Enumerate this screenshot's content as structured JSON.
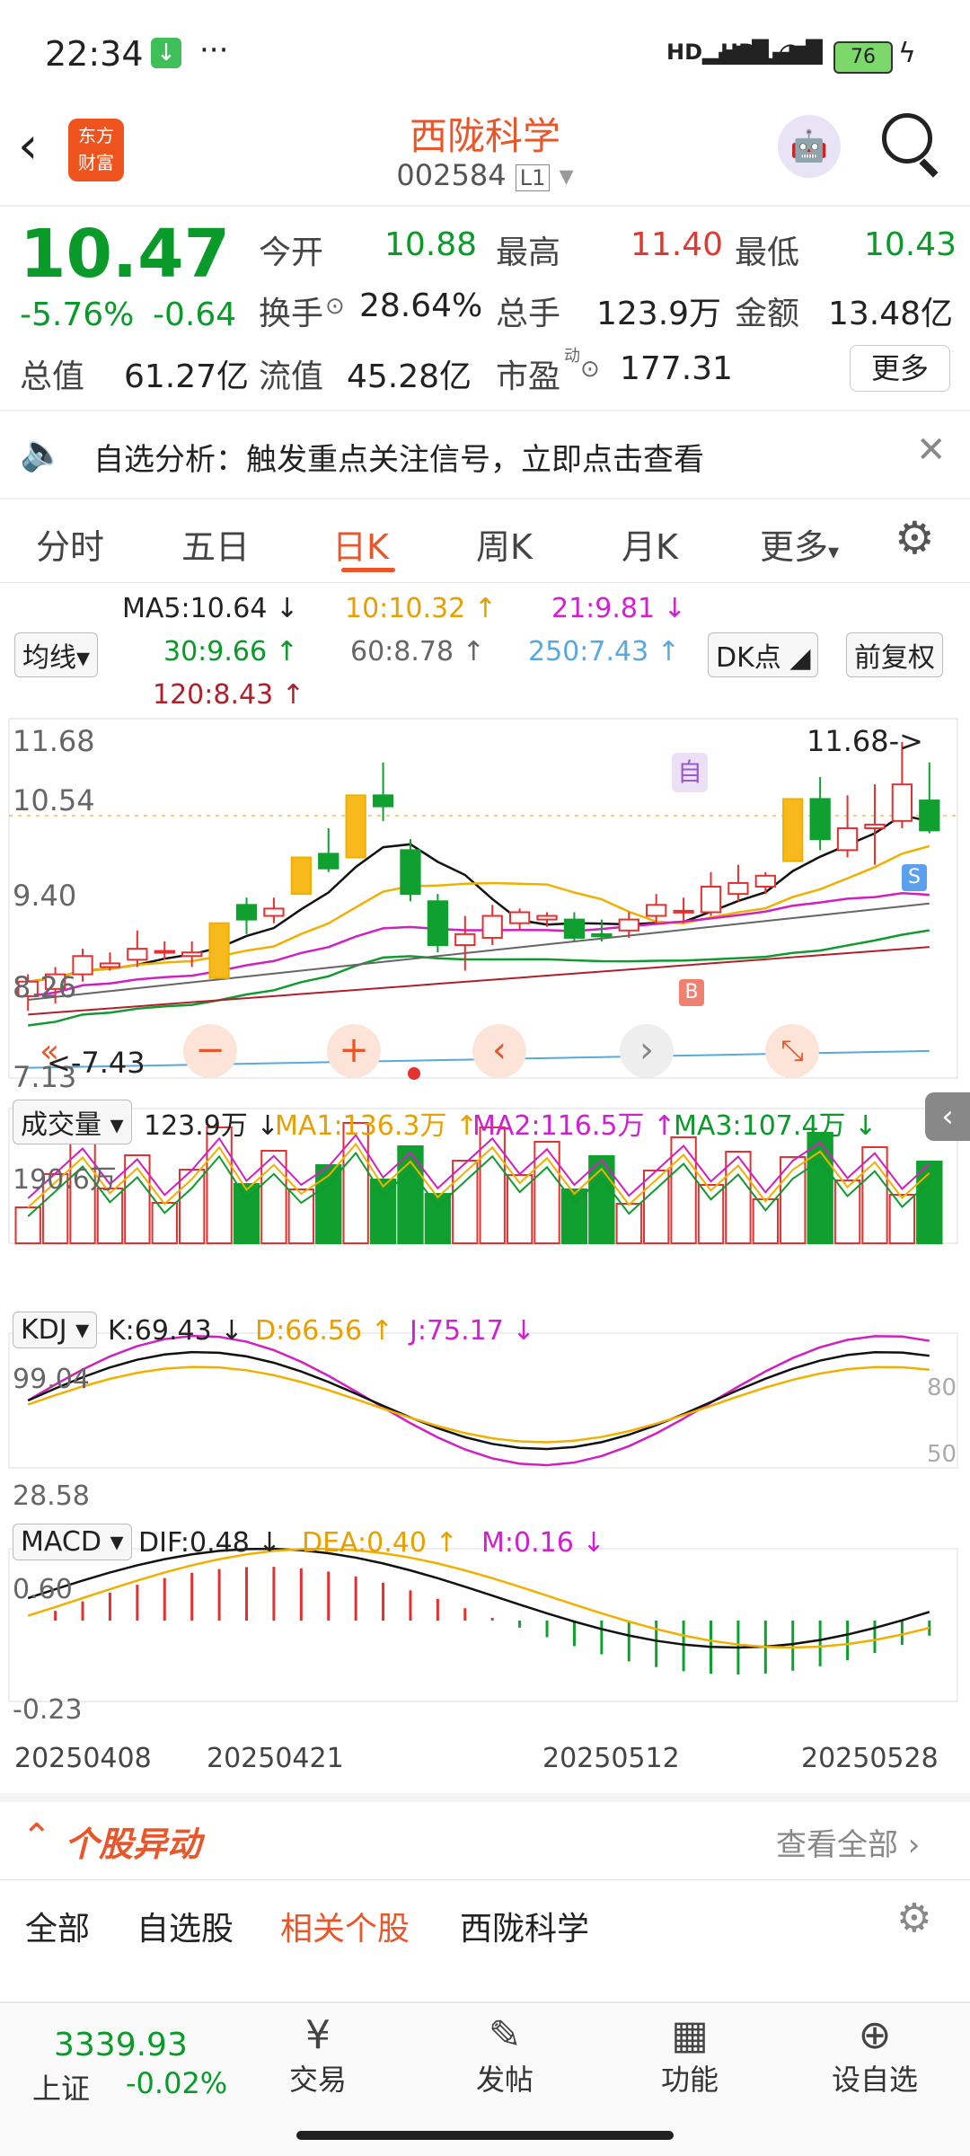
{
  "status_bar": {
    "time": "22:34",
    "battery": "76"
  },
  "header": {
    "title": "西陇科学",
    "code": "002584",
    "market_tag": "L1",
    "logo_line1": "东方",
    "logo_line2": "财富"
  },
  "quote": {
    "price": "10.47",
    "change_pct": "-5.76%",
    "change": "-0.64",
    "fields": [
      {
        "label": "今开",
        "value": "10.88",
        "color": "green"
      },
      {
        "label": "最高",
        "value": "11.40",
        "color": "red"
      },
      {
        "label": "最低",
        "value": "10.43",
        "color": "green"
      },
      {
        "label": "换手",
        "value": "28.64%",
        "color": "black"
      },
      {
        "label": "总手",
        "value": "123.9万",
        "color": "black"
      },
      {
        "label": "金额",
        "value": "13.48亿",
        "color": "black"
      },
      {
        "label": "总值",
        "value": "61.27亿",
        "color": "black"
      },
      {
        "label": "流值",
        "value": "45.28亿",
        "color": "black"
      },
      {
        "label": "市盈",
        "value": "177.31",
        "color": "black"
      }
    ],
    "pe_super": "动",
    "more_label": "更多"
  },
  "banner": {
    "text": "自选分析：触发重点关注信号，立即点击查看"
  },
  "tabs": [
    "分时",
    "五日",
    "日K",
    "周K",
    "月K",
    "更多"
  ],
  "active_tab": "日K",
  "ma": {
    "ma5": "MA5:10.64",
    "ma10": "10:10.32",
    "ma21": "21:9.81",
    "ma30": "30:9.66",
    "ma60": "60:8.78",
    "ma250": "250:7.43",
    "ma120": "120:8.43",
    "select_label": "均线",
    "dk_label": "DK点",
    "fq_label": "前复权"
  },
  "price_axis": {
    "top": "11.68",
    "mid1": "10.54",
    "mid2": "9.40",
    "low1": "8.26",
    "bottom": "7.13",
    "high_marker": "11.68->",
    "low_marker": "<-7.43"
  },
  "chart_data": {
    "type": "candlestick",
    "dates_shown": [
      "20250408",
      "20250421",
      "20250512",
      "20250528"
    ],
    "ylim": [
      7.13,
      11.68
    ],
    "candles": [
      {
        "o": 8.2,
        "c": 8.4,
        "h": 8.5,
        "l": 8.0,
        "up": true
      },
      {
        "o": 8.3,
        "c": 8.5,
        "h": 8.6,
        "l": 8.1,
        "up": true
      },
      {
        "o": 8.5,
        "c": 8.75,
        "h": 8.85,
        "l": 8.4,
        "up": true
      },
      {
        "o": 8.6,
        "c": 8.65,
        "h": 8.8,
        "l": 8.55,
        "up": true
      },
      {
        "o": 8.7,
        "c": 8.85,
        "h": 9.1,
        "l": 8.6,
        "up": true
      },
      {
        "o": 8.8,
        "c": 8.82,
        "h": 8.95,
        "l": 8.7,
        "up": true
      },
      {
        "o": 8.75,
        "c": 8.8,
        "h": 8.95,
        "l": 8.6,
        "up": true
      },
      {
        "o": 8.45,
        "c": 9.2,
        "h": 9.2,
        "l": 8.45,
        "up": true,
        "limit": true
      },
      {
        "o": 9.25,
        "c": 9.45,
        "h": 9.55,
        "l": 9.05,
        "up": false
      },
      {
        "o": 9.3,
        "c": 9.4,
        "h": 9.55,
        "l": 9.2,
        "up": true
      },
      {
        "o": 9.6,
        "c": 10.1,
        "h": 10.1,
        "l": 9.6,
        "up": true,
        "limit": true
      },
      {
        "o": 10.15,
        "c": 9.95,
        "h": 10.5,
        "l": 9.9,
        "up": false
      },
      {
        "o": 10.1,
        "c": 10.95,
        "h": 10.95,
        "l": 10.1,
        "up": true,
        "limit": true
      },
      {
        "o": 10.95,
        "c": 10.8,
        "h": 11.4,
        "l": 10.6,
        "up": false
      },
      {
        "o": 10.2,
        "c": 9.6,
        "h": 10.35,
        "l": 9.5,
        "up": false
      },
      {
        "o": 9.5,
        "c": 8.9,
        "h": 9.6,
        "l": 8.8,
        "up": false
      },
      {
        "o": 8.9,
        "c": 9.05,
        "h": 9.3,
        "l": 8.55,
        "up": true
      },
      {
        "o": 9.0,
        "c": 9.3,
        "h": 9.45,
        "l": 8.9,
        "up": true
      },
      {
        "o": 9.2,
        "c": 9.35,
        "h": 9.4,
        "l": 9.1,
        "up": true
      },
      {
        "o": 9.25,
        "c": 9.3,
        "h": 9.35,
        "l": 9.15,
        "up": true
      },
      {
        "o": 9.25,
        "c": 9.0,
        "h": 9.35,
        "l": 8.95,
        "up": false
      },
      {
        "o": 9.05,
        "c": 9.02,
        "h": 9.25,
        "l": 8.95,
        "up": false
      },
      {
        "o": 9.1,
        "c": 9.25,
        "h": 9.35,
        "l": 9.0,
        "up": true
      },
      {
        "o": 9.3,
        "c": 9.45,
        "h": 9.6,
        "l": 9.2,
        "up": true
      },
      {
        "o": 9.35,
        "c": 9.37,
        "h": 9.55,
        "l": 9.2,
        "up": true
      },
      {
        "o": 9.35,
        "c": 9.7,
        "h": 9.9,
        "l": 9.3,
        "up": true
      },
      {
        "o": 9.6,
        "c": 9.75,
        "h": 10.0,
        "l": 9.5,
        "up": true
      },
      {
        "o": 9.7,
        "c": 9.85,
        "h": 9.9,
        "l": 9.6,
        "up": true
      },
      {
        "o": 10.05,
        "c": 10.9,
        "h": 10.9,
        "l": 10.05,
        "up": true,
        "limit": true
      },
      {
        "o": 10.9,
        "c": 10.35,
        "h": 11.2,
        "l": 10.2,
        "up": false
      },
      {
        "o": 10.2,
        "c": 10.5,
        "h": 10.95,
        "l": 10.1,
        "up": true
      },
      {
        "o": 10.5,
        "c": 10.55,
        "h": 11.1,
        "l": 10.0,
        "up": true
      },
      {
        "o": 10.6,
        "c": 11.1,
        "h": 11.68,
        "l": 10.5,
        "up": true
      },
      {
        "o": 10.88,
        "c": 10.47,
        "h": 11.4,
        "l": 10.43,
        "up": false
      }
    ],
    "volume_label": "成交量",
    "volume_value": "123.9万",
    "vol_ma1": "MA1:136.3万",
    "vol_ma2": "MA2:116.5万",
    "vol_ma3": "MA3:107.4万",
    "volume_max": "190.6万",
    "kdj": {
      "k": "K:69.43",
      "d": "D:66.56",
      "j": "J:75.17",
      "top": "99.04",
      "bottom": "28.58",
      "line80": "80",
      "line50": "50"
    },
    "macd": {
      "dif": "DIF:0.48",
      "dea": "DEA:0.40",
      "m": "M:0.16",
      "top": "0.60",
      "bottom": "-0.23"
    }
  },
  "signals": {
    "zi": "自",
    "b": "B",
    "s": "S"
  },
  "alerts": {
    "title": "个股异动",
    "view_all": "查看全部"
  },
  "subtabs": [
    "全部",
    "自选股",
    "相关个股",
    "西陇科学"
  ],
  "active_subtab": "相关个股",
  "bottom_nav": {
    "index_value": "3339.93",
    "index_name": "上证",
    "index_change": "-0.02%",
    "items": [
      "交易",
      "发帖",
      "功能",
      "设自选"
    ]
  }
}
